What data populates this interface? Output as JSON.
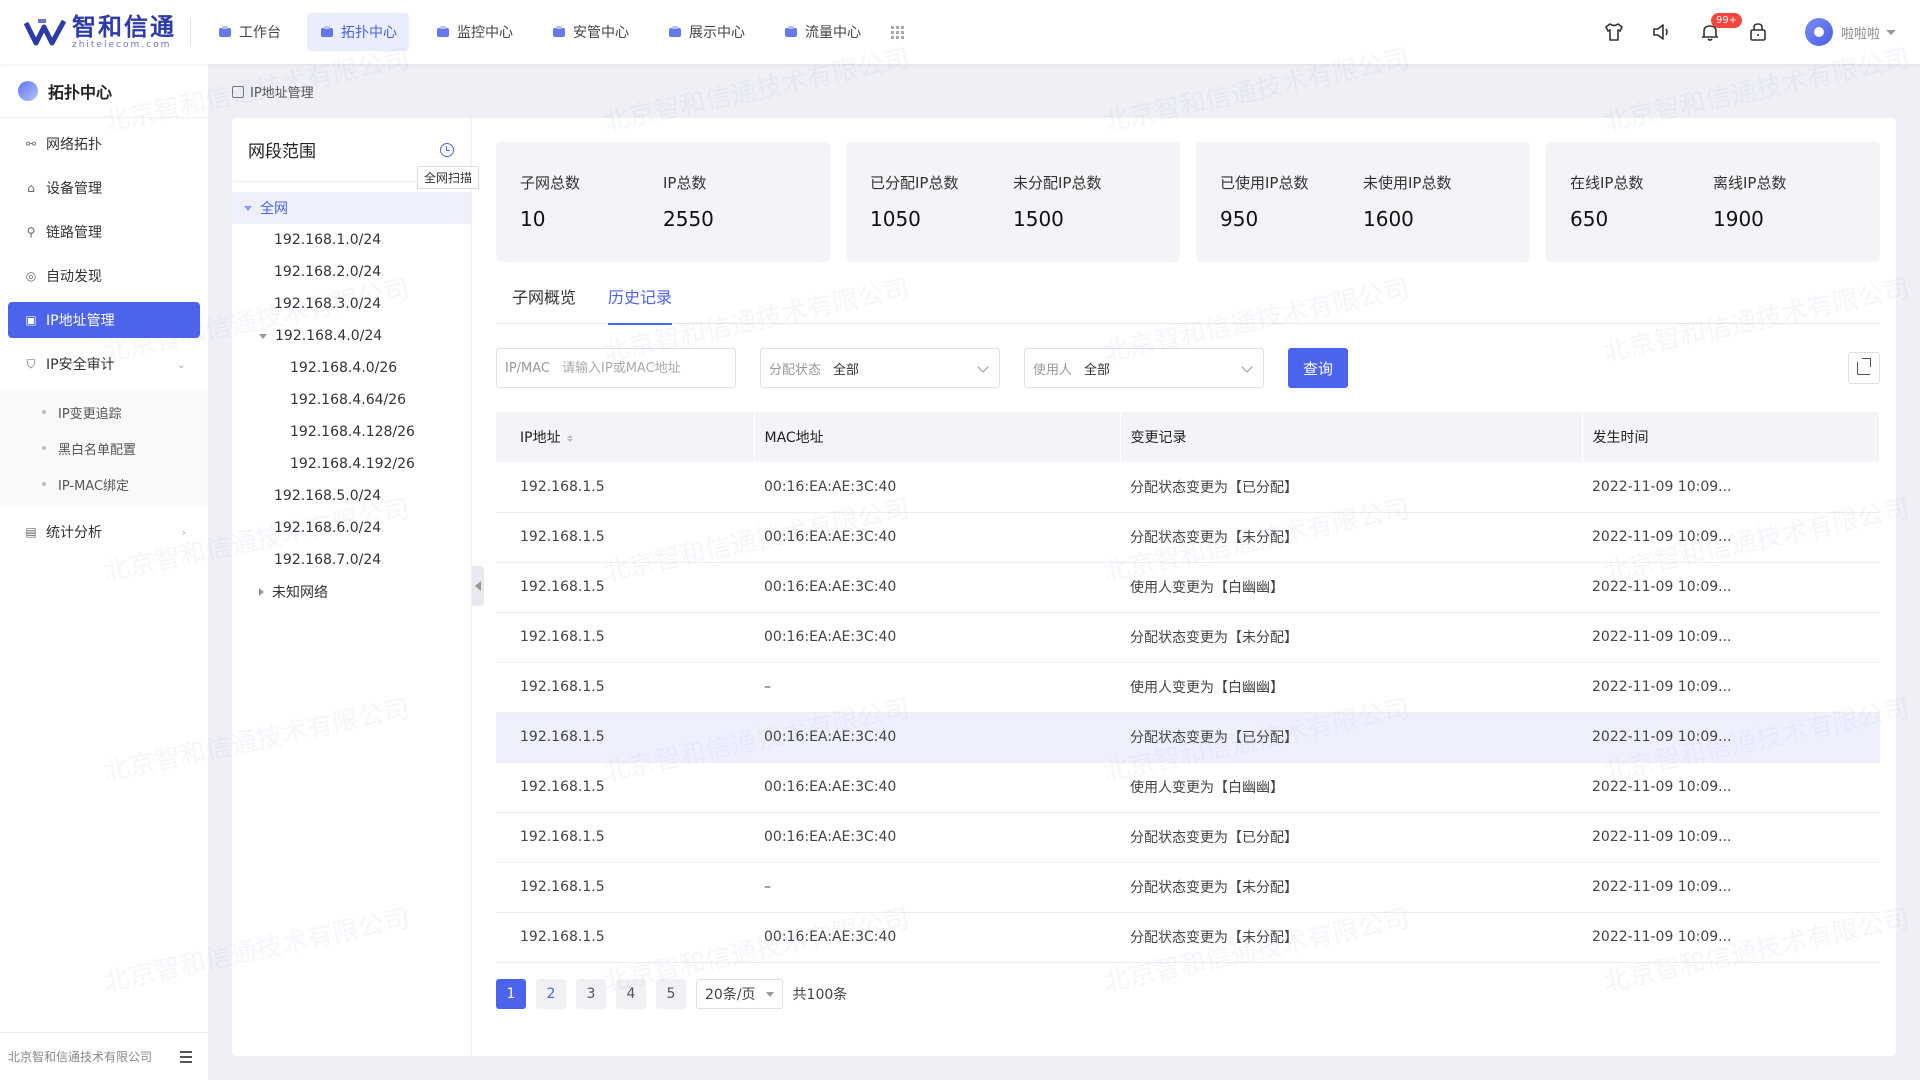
{
  "app": {
    "logo_name": "智和信通",
    "logo_sub": "zhitelecom.com",
    "watermark": "北京智和信通技术有限公司"
  },
  "nav": {
    "items": [
      {
        "label": "工作台",
        "icon": "home-icon"
      },
      {
        "label": "拓扑中心",
        "icon": "topology-icon"
      },
      {
        "label": "监控中心",
        "icon": "monitor-icon"
      },
      {
        "label": "安管中心",
        "icon": "shield-icon"
      },
      {
        "label": "展示中心",
        "icon": "display-icon"
      },
      {
        "label": "流量中心",
        "icon": "traffic-icon"
      }
    ],
    "active_index": 1
  },
  "header_tools": {
    "notification_badge": "99+",
    "user_name": "啦啦啦"
  },
  "sidebar": {
    "title": "拓扑中心",
    "items": [
      {
        "label": "网络拓扑"
      },
      {
        "label": "设备管理"
      },
      {
        "label": "链路管理"
      },
      {
        "label": "自动发现"
      },
      {
        "label": "IP地址管理"
      },
      {
        "label": "IP安全审计"
      }
    ],
    "sub_items": [
      {
        "label": "IP变更追踪"
      },
      {
        "label": "黑白名单配置"
      },
      {
        "label": "IP-MAC绑定"
      }
    ],
    "stats_item": "统计分析",
    "footer": "北京智和信通技术有限公司"
  },
  "breadcrumb": "IP地址管理",
  "tree": {
    "title": "网段范围",
    "tooltip": "全网扫描",
    "root": "全网",
    "nodes": [
      "192.168.1.0/24",
      "192.168.2.0/24",
      "192.168.3.0/24",
      "192.168.4.0/24"
    ],
    "children": [
      "192.168.4.0/26",
      "192.168.4.64/26",
      "192.168.4.128/26",
      "192.168.4.192/26"
    ],
    "nodes_after": [
      "192.168.5.0/24",
      "192.168.6.0/24",
      "192.168.7.0/24"
    ],
    "unknown": "未知网络"
  },
  "stats": [
    {
      "l1": "子网总数",
      "v1": "10",
      "l2": "IP总数",
      "v2": "2550"
    },
    {
      "l1": "已分配IP总数",
      "v1": "1050",
      "l2": "未分配IP总数",
      "v2": "1500"
    },
    {
      "l1": "已使用IP总数",
      "v1": "950",
      "l2": "未使用IP总数",
      "v2": "1600"
    },
    {
      "l1": "在线IP总数",
      "v1": "650",
      "l2": "离线IP总数",
      "v2": "1900"
    }
  ],
  "tabs": [
    {
      "label": "子网概览"
    },
    {
      "label": "历史记录"
    }
  ],
  "filters": {
    "ipmac_label": "IP/MAC",
    "ipmac_placeholder": "请输入IP或MAC地址",
    "status_label": "分配状态",
    "status_value": "全部",
    "user_label": "使用人",
    "user_value": "全部",
    "query": "查询"
  },
  "table": {
    "headers": [
      "IP地址",
      "MAC地址",
      "变更记录",
      "发生时间"
    ],
    "rows": [
      [
        "192.168.1.5",
        "00:16:EA:AE:3C:40",
        "分配状态变更为【已分配】",
        "2022-11-09 10:09..."
      ],
      [
        "192.168.1.5",
        "00:16:EA:AE:3C:40",
        "分配状态变更为【未分配】",
        "2022-11-09 10:09..."
      ],
      [
        "192.168.1.5",
        "00:16:EA:AE:3C:40",
        "使用人变更为【白幽幽】",
        "2022-11-09 10:09..."
      ],
      [
        "192.168.1.5",
        "00:16:EA:AE:3C:40",
        "分配状态变更为【未分配】",
        "2022-11-09 10:09..."
      ],
      [
        "192.168.1.5",
        "–",
        "使用人变更为【白幽幽】",
        "2022-11-09 10:09..."
      ],
      [
        "192.168.1.5",
        "00:16:EA:AE:3C:40",
        "分配状态变更为【已分配】",
        "2022-11-09 10:09..."
      ],
      [
        "192.168.1.5",
        "00:16:EA:AE:3C:40",
        "使用人变更为【白幽幽】",
        "2022-11-09 10:09..."
      ],
      [
        "192.168.1.5",
        "00:16:EA:AE:3C:40",
        "分配状态变更为【已分配】",
        "2022-11-09 10:09..."
      ],
      [
        "192.168.1.5",
        "–",
        "分配状态变更为【未分配】",
        "2022-11-09 10:09..."
      ],
      [
        "192.168.1.5",
        "00:16:EA:AE:3C:40",
        "分配状态变更为【未分配】",
        "2022-11-09 10:09..."
      ]
    ]
  },
  "pager": {
    "pages": [
      "1",
      "2",
      "3",
      "4",
      "5"
    ],
    "page_size": "20条/页",
    "total": "共100条"
  },
  "colors": {
    "primary": "#4c63ec",
    "badge": "#f5453d"
  }
}
